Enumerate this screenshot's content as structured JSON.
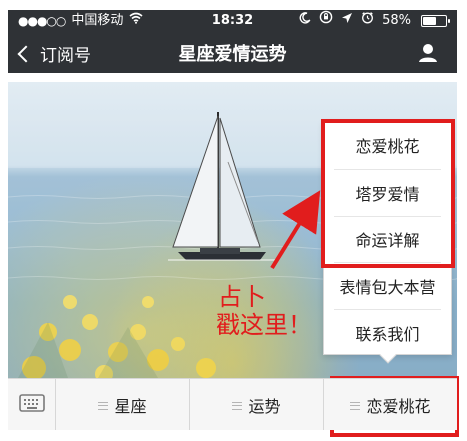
{
  "status_bar": {
    "signal_dots": "●●●○○",
    "carrier": "中国移动",
    "wifi_icon": "wifi-icon",
    "time": "18:32",
    "battery_percent": "58%",
    "battery_level": 0.58
  },
  "nav": {
    "back_label": "订阅号",
    "title": "星座爱情运势",
    "user_icon": "user-icon"
  },
  "popup_menu": {
    "items": [
      {
        "label": "恋爱桃花"
      },
      {
        "label": "塔罗爱情"
      },
      {
        "label": "命运详解"
      },
      {
        "label": "表情包大本营"
      },
      {
        "label": "联系我们"
      }
    ]
  },
  "annotation": {
    "line1": "占卜",
    "line2": "戳这里！"
  },
  "bottom_menu": {
    "keyboard_icon": "keyboard-icon",
    "tabs": [
      {
        "label": "星座"
      },
      {
        "label": "运势"
      },
      {
        "label": "恋爱桃花"
      }
    ]
  },
  "colors": {
    "top_bar_bg": "#2f3236",
    "highlight_red": "#e11d1d",
    "menu_bg": "#ffffff",
    "bottom_bg": "#f6f6f6"
  }
}
